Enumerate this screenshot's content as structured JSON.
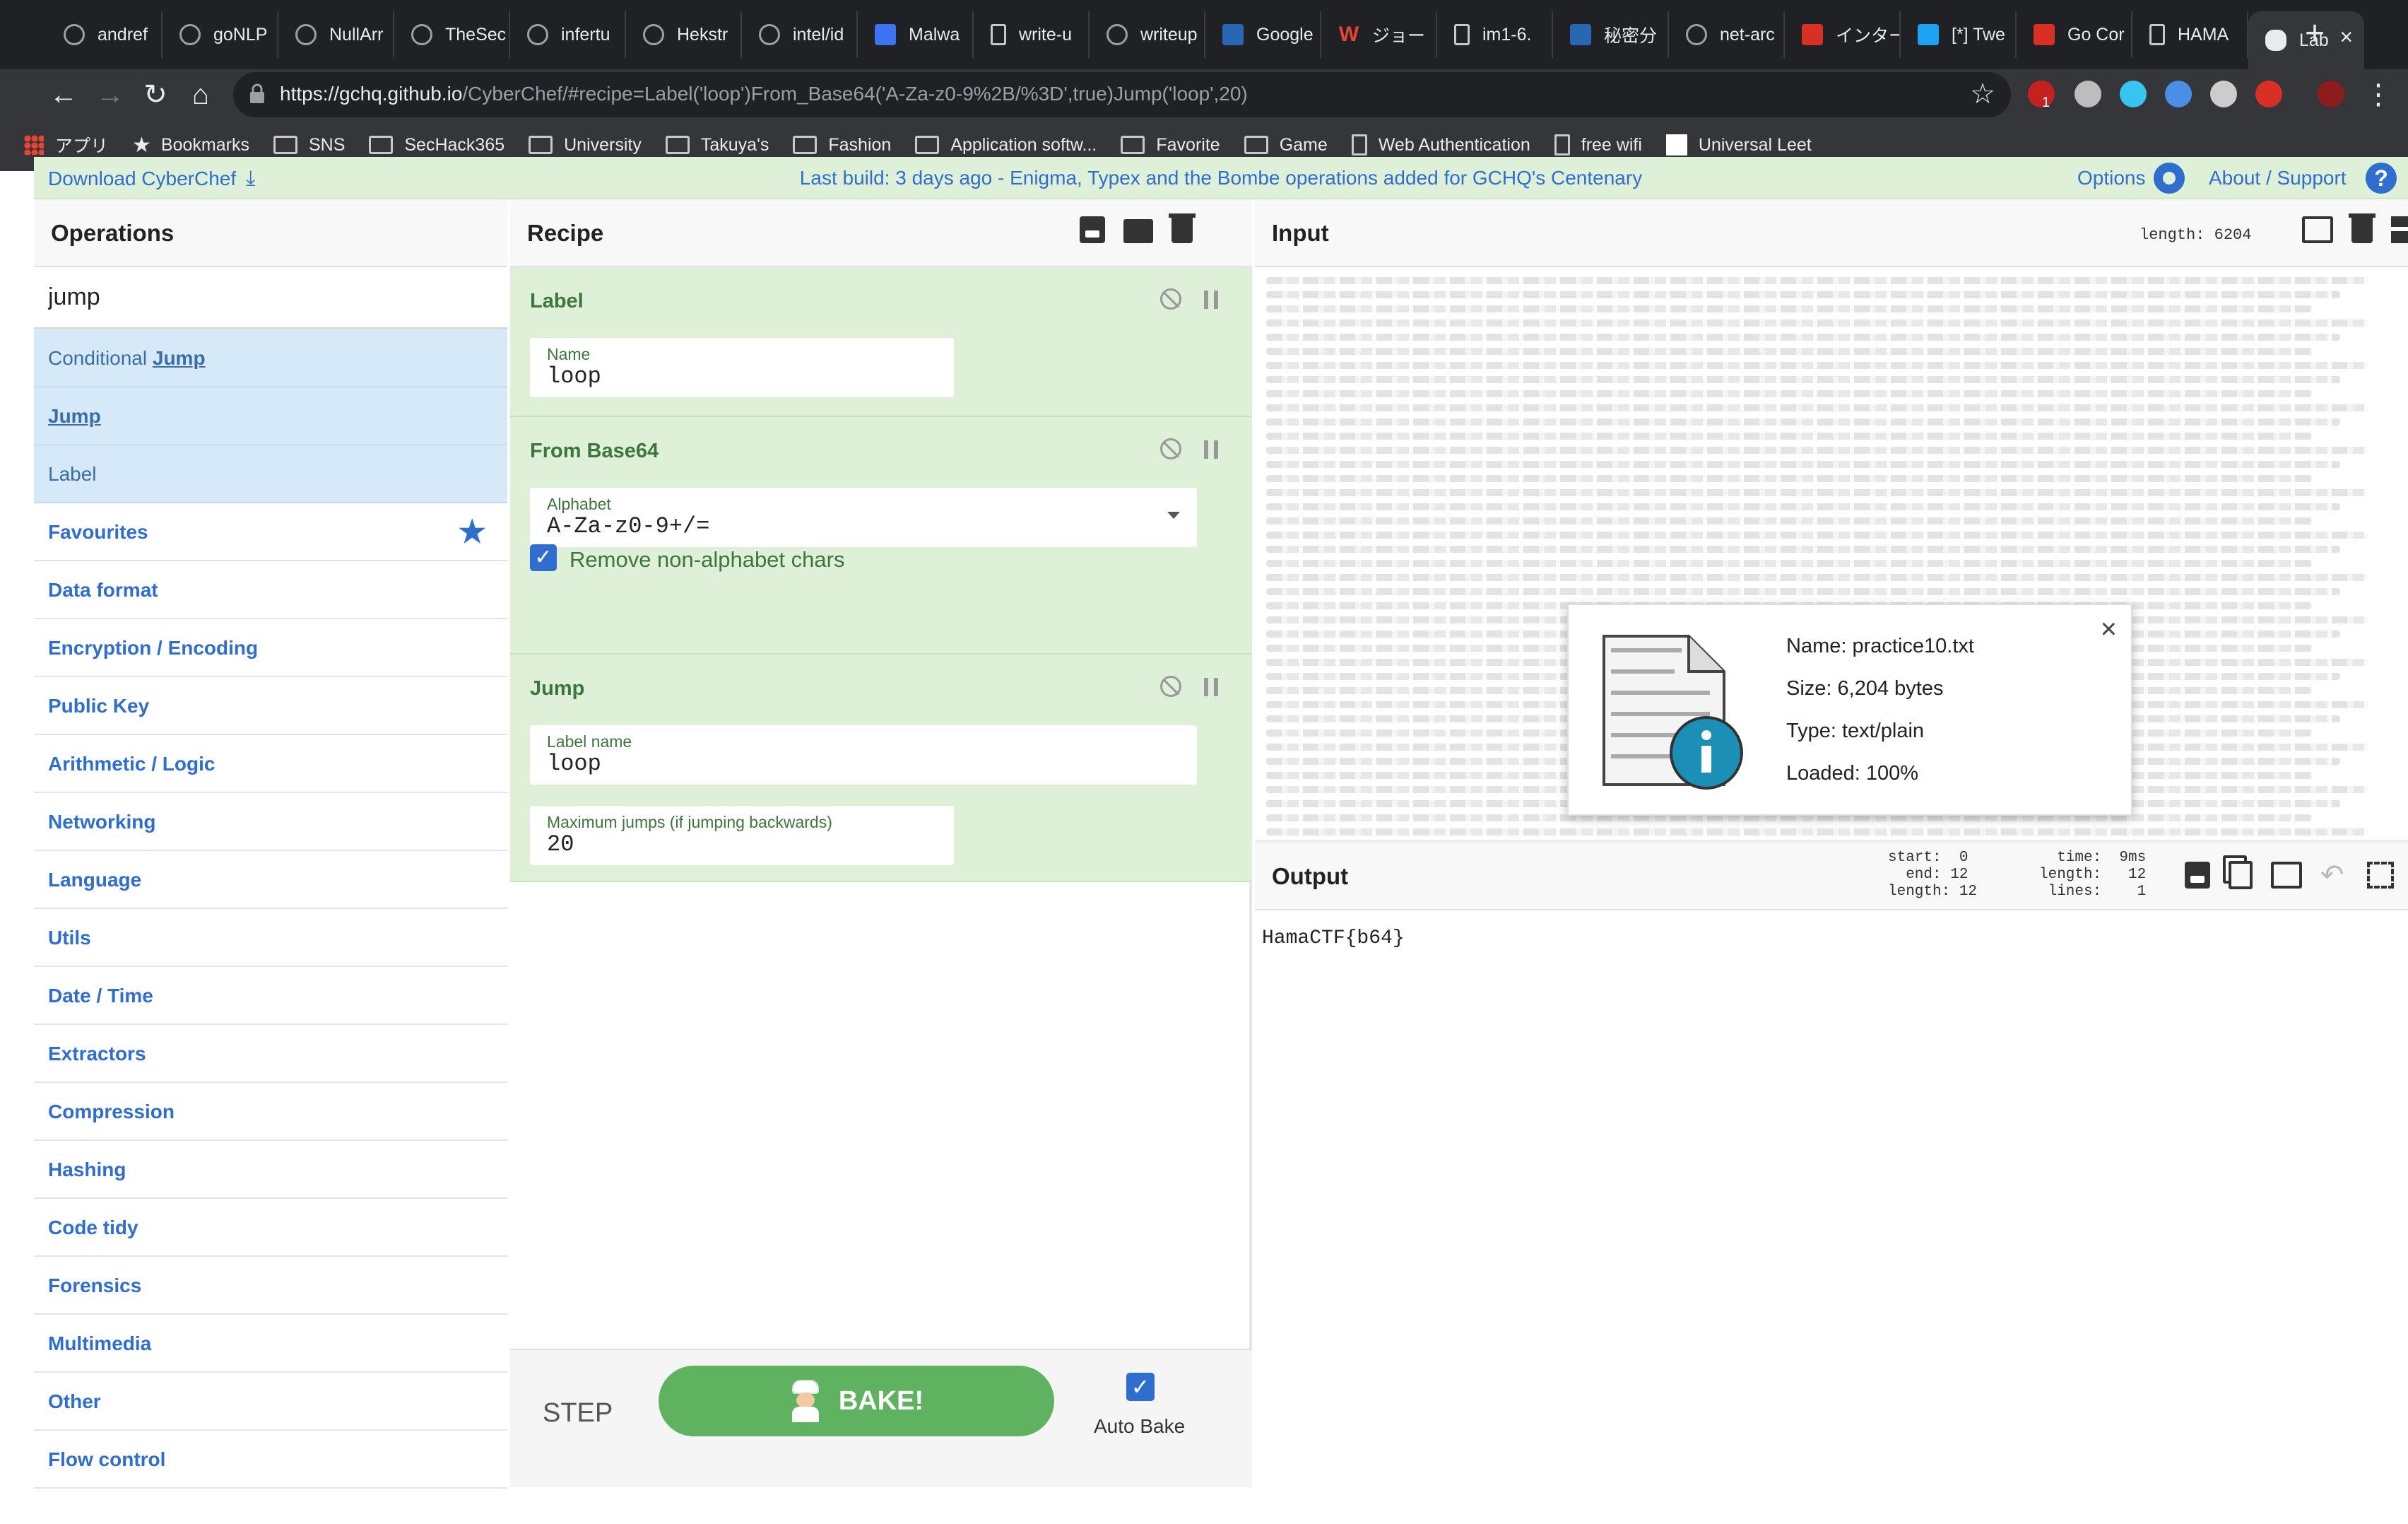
{
  "browser": {
    "tabs": [
      {
        "label": "andref",
        "icon": "github-icon"
      },
      {
        "label": "goNLP",
        "icon": "github-icon"
      },
      {
        "label": "NullArr",
        "icon": "github-icon"
      },
      {
        "label": "TheSec",
        "icon": "github-icon"
      },
      {
        "label": "infertu",
        "icon": "github-icon"
      },
      {
        "label": "Hekstr",
        "icon": "github-icon"
      },
      {
        "label": "intel/id",
        "icon": "github-icon"
      },
      {
        "label": "Malwa",
        "icon": "malwarebytes-icon"
      },
      {
        "label": "write-u",
        "icon": "document-icon"
      },
      {
        "label": "writeup",
        "icon": "github-icon"
      },
      {
        "label": "Google",
        "icon": "google-translate-icon"
      },
      {
        "label": "ジョー",
        "icon": "w-icon"
      },
      {
        "label": "im1-6.",
        "icon": "document-icon"
      },
      {
        "label": "秘密分",
        "icon": "linkedin-icon"
      },
      {
        "label": "net-arc",
        "icon": "github-icon"
      },
      {
        "label": "インター",
        "icon": "globe-icon"
      },
      {
        "label": "[*] Twe",
        "icon": "twitter-icon"
      },
      {
        "label": "Go Cor",
        "icon": "c-icon"
      },
      {
        "label": "HAMA",
        "icon": "document-icon"
      },
      {
        "label": "Lab",
        "icon": "cyberchef-icon"
      }
    ],
    "url_host": "https://gchq.github.io",
    "url_rest": "/CyberChef/#recipe=Label('loop')From_Base64('A-Za-z0-9%2B/%3D',true)Jump('loop',20)",
    "extension_badge": "1",
    "bookmarks": [
      "アプリ",
      "Bookmarks",
      "SNS",
      "SecHack365",
      "University",
      "Takuya's",
      "Fashion",
      "Application softw...",
      "Favorite",
      "Game",
      "Web Authentication",
      "free wifi",
      "Universal Leet"
    ]
  },
  "banner": {
    "download": "Download CyberChef",
    "build": "Last build: 3 days ago - Enigma, Typex and the Bombe operations added for GCHQ's Centenary",
    "options": "Options",
    "about": "About / Support"
  },
  "operations": {
    "title": "Operations",
    "search_value": "jump",
    "results": [
      {
        "prefix": "Conditional ",
        "match": "Jump"
      },
      {
        "prefix": "",
        "match": "Jump"
      },
      {
        "prefix": "Label",
        "match": ""
      }
    ],
    "categories": [
      "Favourites",
      "Data format",
      "Encryption / Encoding",
      "Public Key",
      "Arithmetic / Logic",
      "Networking",
      "Language",
      "Utils",
      "Date / Time",
      "Extractors",
      "Compression",
      "Hashing",
      "Code tidy",
      "Forensics",
      "Multimedia",
      "Other",
      "Flow control"
    ]
  },
  "recipe": {
    "title": "Recipe",
    "ops": {
      "label": {
        "name": "Label",
        "field_label": "Name",
        "field_value": "loop"
      },
      "from_base64": {
        "name": "From Base64",
        "field_label": "Alphabet",
        "field_value": "A-Za-z0-9+/=",
        "checkbox_label": "Remove non-alphabet chars",
        "checked": true
      },
      "jump": {
        "name": "Jump",
        "field1_label": "Label name",
        "field1_value": "loop",
        "field2_label": "Maximum jumps (if jumping backwards)",
        "field2_value": "20"
      }
    },
    "step": "STEP",
    "bake": "BAKE!",
    "auto_bake": "Auto Bake"
  },
  "input": {
    "title": "Input",
    "length": "length: 6204"
  },
  "file_info": {
    "name": "Name: practice10.txt",
    "size": "Size: 6,204 bytes",
    "type": "Type: text/plain",
    "loaded": "Loaded: 100%"
  },
  "output": {
    "title": "Output",
    "stats_left": "start:  0\n  end: 12\nlength: 12",
    "stats_right": "  time:  9ms\nlength:   12\n lines:    1",
    "text": "HamaCTF{b64}"
  },
  "colors": {
    "accent_blue": "#2f6ecf",
    "recipe_green": "#dff0d8",
    "bake_green": "#5fb25f",
    "search_result_bg": "#d6e9f8"
  }
}
